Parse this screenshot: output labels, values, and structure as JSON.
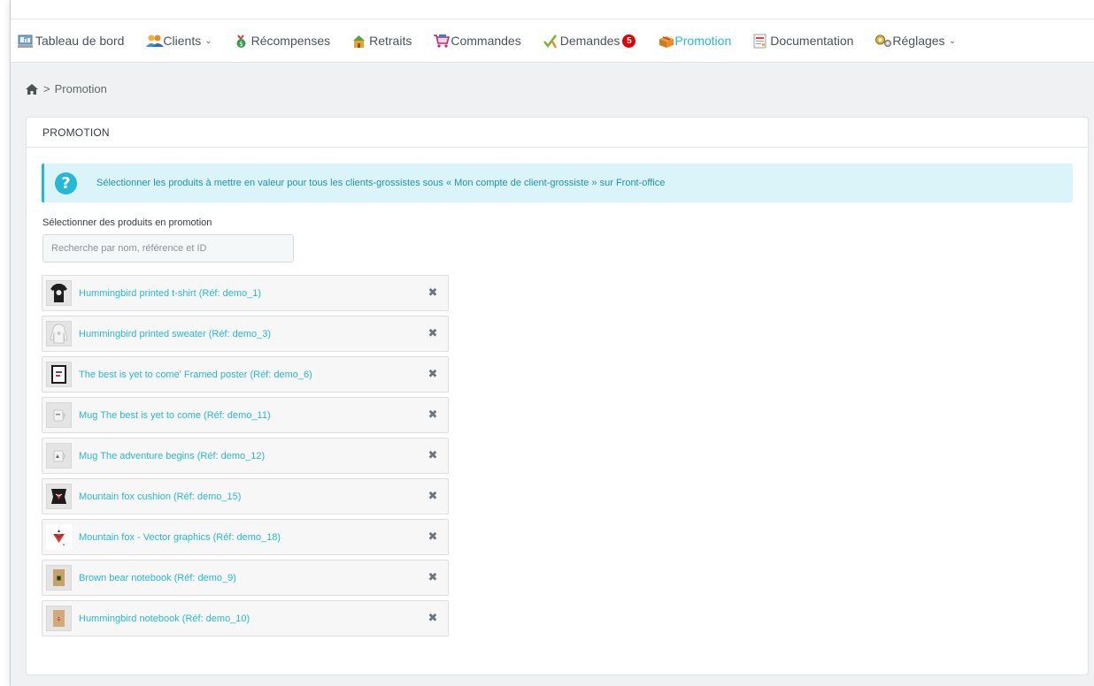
{
  "nav": {
    "items": [
      {
        "label": "Tableau de bord",
        "icon": "dashboard-icon"
      },
      {
        "label": "Clients",
        "icon": "clients-icon",
        "dropdown": true
      },
      {
        "label": "Récompenses",
        "icon": "rewards-icon"
      },
      {
        "label": "Retraits",
        "icon": "withdrawals-icon"
      },
      {
        "label": "Commandes",
        "icon": "orders-icon"
      },
      {
        "label": "Demandes",
        "icon": "requests-icon",
        "badge": "5"
      },
      {
        "label": "Promotion",
        "icon": "promotion-icon",
        "active": true
      },
      {
        "label": "Documentation",
        "icon": "documentation-icon"
      },
      {
        "label": "Réglages",
        "icon": "settings-icon",
        "dropdown": true
      }
    ],
    "active_color": "#25b9d7",
    "badge_color": "#e00000"
  },
  "breadcrumb": {
    "separator": ">",
    "current": "Promotion"
  },
  "panel": {
    "heading": "PROMOTION",
    "alert_text": "Sélectionner les produits à mettre en valeur pour tous les clients-grossistes sous « Mon compte de client-grossiste » sur Front-office",
    "field_label": "Sélectionner des produits en promotion",
    "search_placeholder": "Recherche par nom, référence et ID",
    "products": [
      {
        "label": "Hummingbird printed t-shirt (Réf: demo_1)",
        "thumb": "tshirt"
      },
      {
        "label": "Hummingbird printed sweater (Réf: demo_3)",
        "thumb": "sweater"
      },
      {
        "label": "The best is yet to come' Framed poster (Réf: demo_6)",
        "thumb": "poster"
      },
      {
        "label": "Mug The best is yet to come (Réf: demo_11)",
        "thumb": "mug"
      },
      {
        "label": "Mug The adventure begins (Réf: demo_12)",
        "thumb": "mug"
      },
      {
        "label": "Mountain fox cushion (Réf: demo_15)",
        "thumb": "cushion"
      },
      {
        "label": "Mountain fox - Vector graphics (Réf: demo_18)",
        "thumb": "vector"
      },
      {
        "label": "Brown bear notebook (Réf: demo_9)",
        "thumb": "notebook"
      },
      {
        "label": "Hummingbird notebook (Réf: demo_10)",
        "thumb": "notebook"
      }
    ]
  }
}
